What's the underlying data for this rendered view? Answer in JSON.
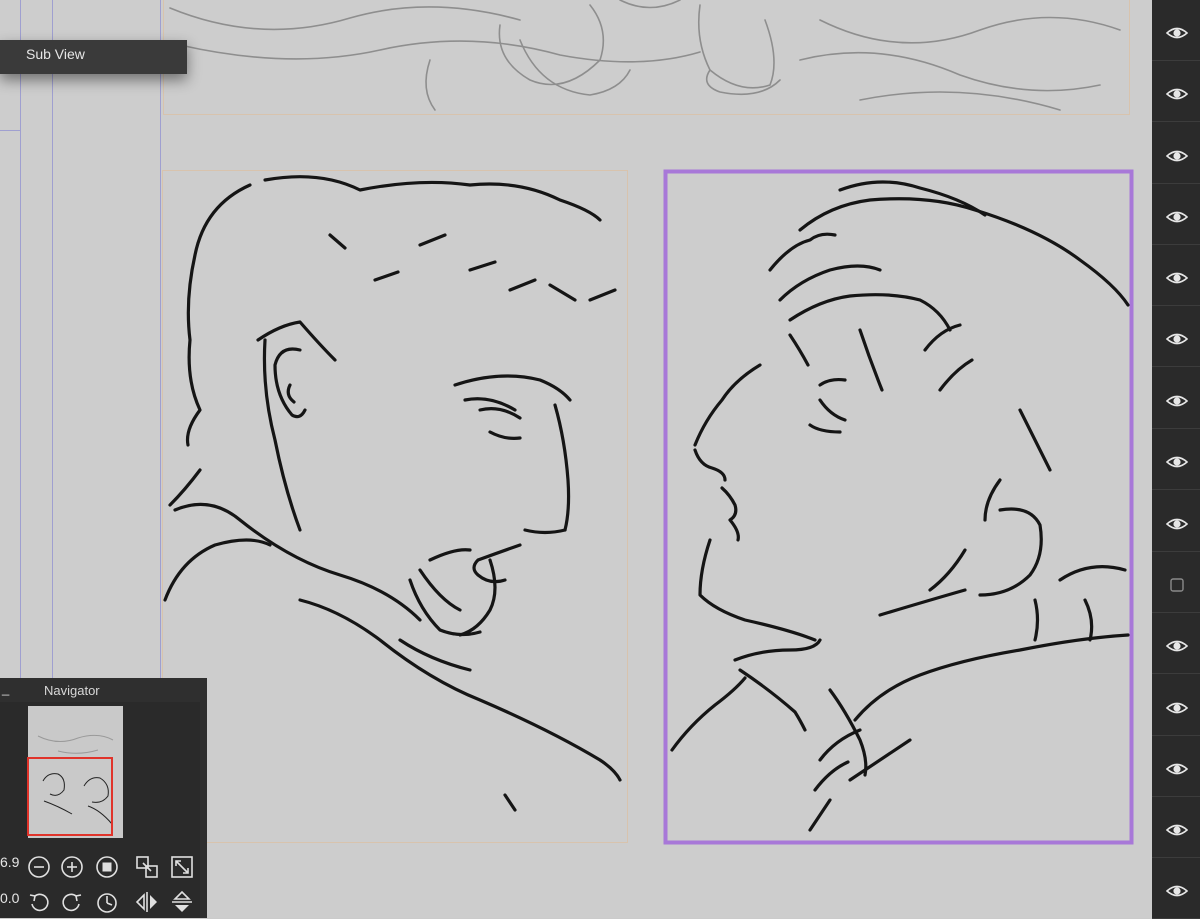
{
  "subview": {
    "label": "Sub View"
  },
  "navigator": {
    "title": "Navigator",
    "minimize": "_",
    "zoom_value": "6.9",
    "rotate_value": "0.0",
    "zoom_buttons": [
      "zoom-out",
      "zoom-in",
      "stop"
    ],
    "rotate_buttons": [
      "rotate-left",
      "rotate-right",
      "reset-rotation"
    ],
    "view_buttons": [
      "fit-to-window",
      "actual-size"
    ],
    "flip_buttons": [
      "flip-horizontal",
      "flip-vertical"
    ]
  },
  "layers_panel": {
    "rows": [
      {
        "icon": "eye-icon"
      },
      {
        "icon": "eye-icon"
      },
      {
        "icon": "eye-icon"
      },
      {
        "icon": "eye-icon"
      },
      {
        "icon": "eye-icon"
      },
      {
        "icon": "eye-icon"
      },
      {
        "icon": "eye-icon"
      },
      {
        "icon": "eye-icon"
      },
      {
        "icon": "eye-icon"
      },
      {
        "icon": "checkbox-icon"
      },
      {
        "icon": "eye-icon"
      },
      {
        "icon": "eye-icon"
      },
      {
        "icon": "eye-icon"
      },
      {
        "icon": "eye-icon"
      },
      {
        "icon": "eye-icon"
      }
    ]
  },
  "colors": {
    "canvas": "#cdcdcd",
    "selection": "#a878d8",
    "panel": "#2a2a2a",
    "navigator_frame": "#e0332a"
  }
}
